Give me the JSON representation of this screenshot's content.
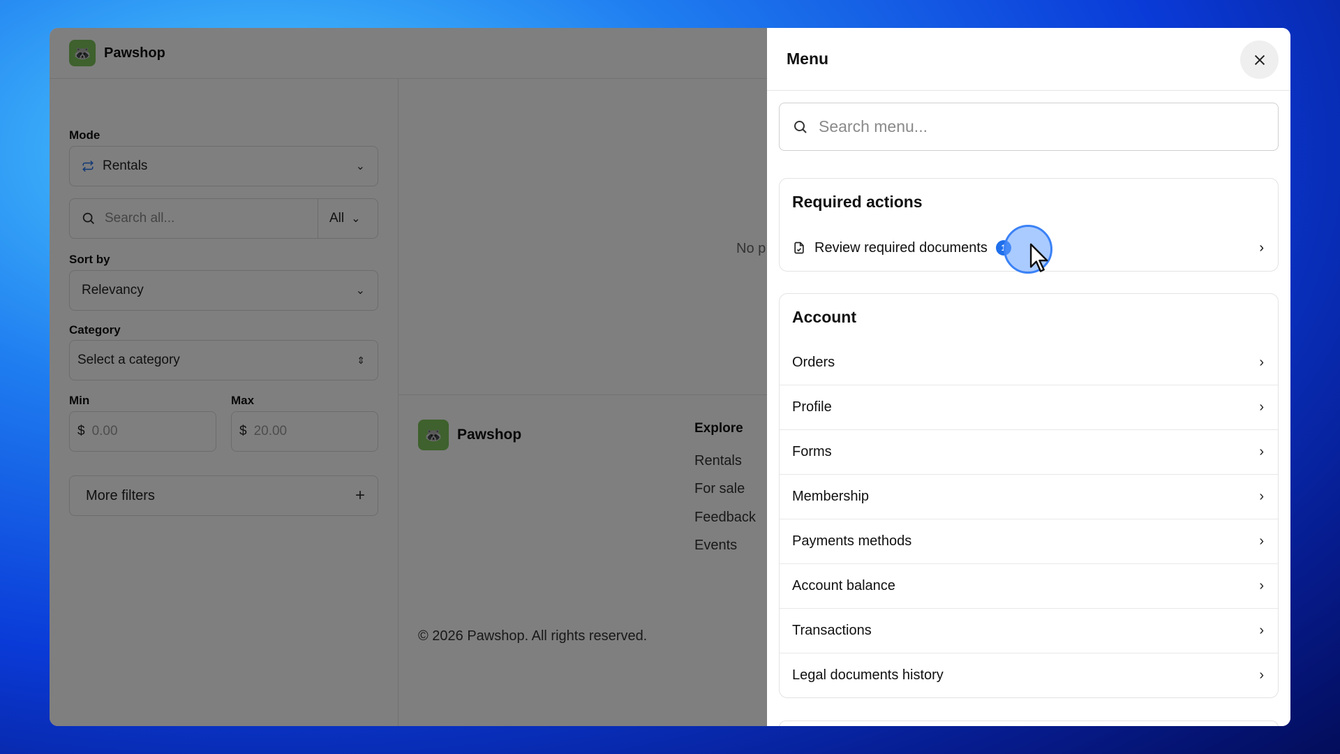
{
  "app": {
    "brand": "Pawshop",
    "logo_icon": "raccoon-logo"
  },
  "sidebar": {
    "mode_label": "Mode",
    "mode_value": "Rentals",
    "search_placeholder": "Search all...",
    "search_scope": "All",
    "sort_label": "Sort by",
    "sort_value": "Relevancy",
    "category_label": "Category",
    "category_placeholder": "Select a category",
    "min_label": "Min",
    "max_label": "Max",
    "currency": "$",
    "min_placeholder": "0.00",
    "max_placeholder": "20.00",
    "more_filters": "More filters"
  },
  "main": {
    "empty_text": "No p",
    "footer_brand": "Pawshop",
    "explore_title": "Explore",
    "explore_links": [
      "Rentals",
      "For sale",
      "Feedback",
      "Events"
    ],
    "copyright": "© 2026 Pawshop. All rights reserved."
  },
  "drawer": {
    "title": "Menu",
    "search_placeholder": "Search menu...",
    "required": {
      "title": "Required actions",
      "item_label": "Review required documents",
      "badge": "1"
    },
    "account": {
      "title": "Account",
      "items": [
        "Orders",
        "Profile",
        "Forms",
        "Membership",
        "Payments methods",
        "Account balance",
        "Transactions",
        "Legal documents history"
      ]
    }
  },
  "colors": {
    "accent": "#1f6feb",
    "logo_bg": "#7cc35a",
    "overlay": "rgba(0,0,0,0.5)"
  }
}
